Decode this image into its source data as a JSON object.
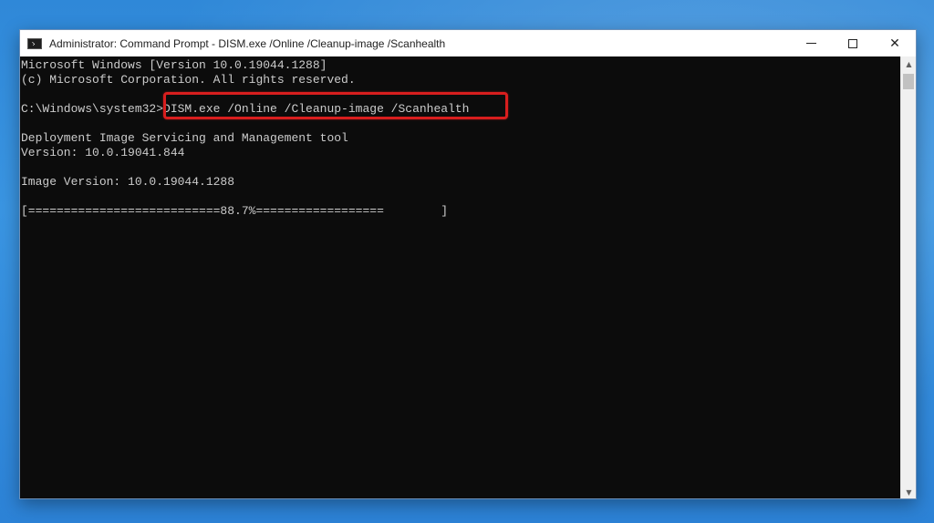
{
  "window": {
    "title": "Administrator: Command Prompt - DISM.exe  /Online /Cleanup-image /Scanhealth",
    "app_icon": "cmd-icon",
    "controls": {
      "minimize": "minimize-icon",
      "maximize": "maximize-icon",
      "close_label": "✕"
    }
  },
  "console": {
    "lines": [
      "Microsoft Windows [Version 10.0.19044.1288]",
      "(c) Microsoft Corporation. All rights reserved.",
      "",
      "C:\\Windows\\system32>DISM.exe /Online /Cleanup-image /Scanhealth",
      "",
      "Deployment Image Servicing and Management tool",
      "Version: 10.0.19041.844",
      "",
      "Image Version: 10.0.19044.1288",
      "",
      "[===========================88.7%==================        ]"
    ],
    "progress_percent": 88.7,
    "highlight_color": "#d81e1e",
    "background_color": "#0c0c0c",
    "text_color": "#cccccc"
  },
  "scrollbar": {
    "up_arrow": "▲",
    "down_arrow": "▼"
  }
}
